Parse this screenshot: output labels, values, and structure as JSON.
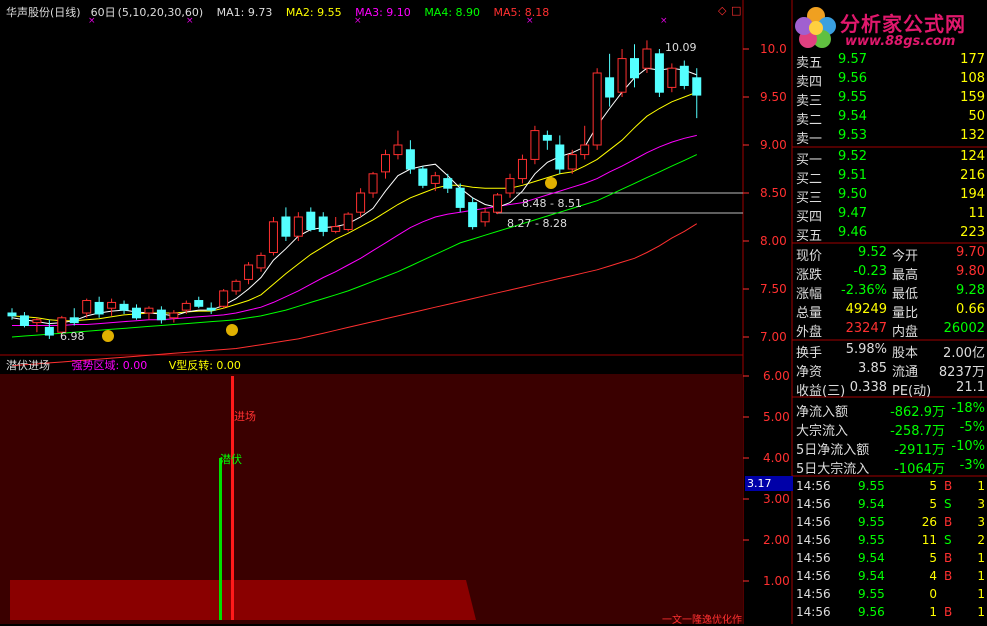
{
  "header": {
    "stock_name": "华声股份(日线)",
    "interval": "60日",
    "ma_params": "(5,10,20,30,60)",
    "ma1": "MA1: 9.73",
    "ma2": "MA2: 9.55",
    "ma3": "MA3: 9.10",
    "ma4": "MA4: 8.90",
    "ma5": "MA5: 8.18",
    "colors": {
      "ma1": "#ffffff",
      "ma2": "#ffff00",
      "ma3": "#ff00ff",
      "ma4": "#00ff00",
      "ma5": "#ff3030"
    }
  },
  "sub_header": {
    "title": "潜伏进场",
    "field1": "强势区域: 0.00",
    "field2": "V型反转: 0.00"
  },
  "price_axis": [
    "10.0",
    "9.50",
    "9.00",
    "8.50",
    "8.00",
    "7.50",
    "7.00"
  ],
  "indicator_axis": [
    "6.00",
    "5.00",
    "4.00",
    "3.00",
    "2.00",
    "1.00"
  ],
  "axis_tag": "3.17",
  "annotations": {
    "high": "10.09",
    "low": "6.98",
    "range1": "8.48 - 8.51",
    "range2": "8.27 - 8.28",
    "signal_enter": "进场",
    "signal_lurk": "潜伏",
    "footer": "一文一隆逸优化作"
  },
  "logo": {
    "title": "分析家公式网",
    "url": "www.88gs.com"
  },
  "order_book": {
    "sell": [
      {
        "label": "卖五",
        "price": "9.57",
        "vol": "177"
      },
      {
        "label": "卖四",
        "price": "9.56",
        "vol": "108"
      },
      {
        "label": "卖三",
        "price": "9.55",
        "vol": "159"
      },
      {
        "label": "卖二",
        "price": "9.54",
        "vol": "50"
      },
      {
        "label": "卖一",
        "price": "9.53",
        "vol": "132"
      }
    ],
    "buy": [
      {
        "label": "买一",
        "price": "9.52",
        "vol": "124"
      },
      {
        "label": "买二",
        "price": "9.51",
        "vol": "216"
      },
      {
        "label": "买三",
        "price": "9.50",
        "vol": "194"
      },
      {
        "label": "买四",
        "price": "9.47",
        "vol": "11"
      },
      {
        "label": "买五",
        "price": "9.46",
        "vol": "223"
      }
    ]
  },
  "stats": [
    {
      "l1": "现价",
      "v1": "9.52",
      "c1": "g",
      "l2": "今开",
      "v2": "9.70",
      "c2": "r"
    },
    {
      "l1": "涨跌",
      "v1": "-0.23",
      "c1": "g",
      "l2": "最高",
      "v2": "9.80",
      "c2": "r"
    },
    {
      "l1": "涨幅",
      "v1": "-2.36%",
      "c1": "g",
      "l2": "最低",
      "v2": "9.28",
      "c2": "g"
    },
    {
      "l1": "总量",
      "v1": "49249",
      "c1": "y",
      "l2": "量比",
      "v2": "0.66",
      "c2": "y"
    },
    {
      "l1": "外盘",
      "v1": "23247",
      "c1": "r",
      "l2": "内盘",
      "v2": "26002",
      "c2": "g"
    }
  ],
  "stats2": [
    {
      "l1": "换手",
      "v1": "5.98%",
      "l2": "股本",
      "v2": "2.00亿"
    },
    {
      "l1": "净资",
      "v1": "3.85",
      "l2": "流通",
      "v2": "8237万"
    },
    {
      "l1": "收益(三)",
      "v1": "0.338",
      "l2": "PE(动)",
      "v2": "21.1"
    }
  ],
  "flows": [
    {
      "label": "净流入额",
      "value": "-862.9万",
      "pct": "-18%"
    },
    {
      "label": "大宗流入",
      "value": "-258.7万",
      "pct": "-5%"
    },
    {
      "label": "5日净流入额",
      "value": "-2911万",
      "pct": "-10%"
    },
    {
      "label": "5日大宗流入",
      "value": "-1064万",
      "pct": "-3%"
    }
  ],
  "ticks": [
    {
      "time": "14:56",
      "price": "9.55",
      "vol": "5",
      "bs": "B",
      "n": "1"
    },
    {
      "time": "14:56",
      "price": "9.54",
      "vol": "5",
      "bs": "S",
      "n": "3"
    },
    {
      "time": "14:56",
      "price": "9.55",
      "vol": "26",
      "bs": "B",
      "n": "3"
    },
    {
      "time": "14:56",
      "price": "9.55",
      "vol": "11",
      "bs": "S",
      "n": "2"
    },
    {
      "time": "14:56",
      "price": "9.54",
      "vol": "5",
      "bs": "B",
      "n": "1"
    },
    {
      "time": "14:56",
      "price": "9.54",
      "vol": "4",
      "bs": "B",
      "n": "1"
    },
    {
      "time": "14:56",
      "price": "9.55",
      "vol": "0",
      "bs": "",
      "n": "1"
    },
    {
      "time": "14:56",
      "price": "9.56",
      "vol": "1",
      "bs": "B",
      "n": "1"
    }
  ],
  "chart_data": {
    "type": "candlestick",
    "ylim": [
      6.85,
      10.3
    ],
    "candles": [
      {
        "o": 7.25,
        "h": 7.3,
        "l": 7.18,
        "c": 7.22
      },
      {
        "o": 7.22,
        "h": 7.26,
        "l": 7.1,
        "c": 7.12
      },
      {
        "o": 7.15,
        "h": 7.2,
        "l": 7.05,
        "c": 7.18
      },
      {
        "o": 7.1,
        "h": 7.18,
        "l": 6.98,
        "c": 7.02
      },
      {
        "o": 7.05,
        "h": 7.22,
        "l": 7.02,
        "c": 7.2
      },
      {
        "o": 7.2,
        "h": 7.3,
        "l": 7.12,
        "c": 7.15
      },
      {
        "o": 7.25,
        "h": 7.4,
        "l": 7.2,
        "c": 7.38
      },
      {
        "o": 7.36,
        "h": 7.42,
        "l": 7.2,
        "c": 7.24
      },
      {
        "o": 7.3,
        "h": 7.4,
        "l": 7.22,
        "c": 7.36
      },
      {
        "o": 7.34,
        "h": 7.38,
        "l": 7.24,
        "c": 7.28
      },
      {
        "o": 7.3,
        "h": 7.34,
        "l": 7.18,
        "c": 7.2
      },
      {
        "o": 7.25,
        "h": 7.32,
        "l": 7.18,
        "c": 7.3
      },
      {
        "o": 7.28,
        "h": 7.32,
        "l": 7.14,
        "c": 7.18
      },
      {
        "o": 7.2,
        "h": 7.28,
        "l": 7.15,
        "c": 7.25
      },
      {
        "o": 7.28,
        "h": 7.38,
        "l": 7.24,
        "c": 7.35
      },
      {
        "o": 7.38,
        "h": 7.42,
        "l": 7.3,
        "c": 7.32
      },
      {
        "o": 7.3,
        "h": 7.36,
        "l": 7.24,
        "c": 7.28
      },
      {
        "o": 7.32,
        "h": 7.5,
        "l": 7.3,
        "c": 7.48
      },
      {
        "o": 7.48,
        "h": 7.6,
        "l": 7.44,
        "c": 7.58
      },
      {
        "o": 7.6,
        "h": 7.78,
        "l": 7.55,
        "c": 7.75
      },
      {
        "o": 7.72,
        "h": 7.88,
        "l": 7.68,
        "c": 7.85
      },
      {
        "o": 7.88,
        "h": 8.25,
        "l": 7.85,
        "c": 8.2
      },
      {
        "o": 8.25,
        "h": 8.35,
        "l": 8.0,
        "c": 8.05
      },
      {
        "o": 8.05,
        "h": 8.3,
        "l": 8.0,
        "c": 8.25
      },
      {
        "o": 8.3,
        "h": 8.35,
        "l": 8.1,
        "c": 8.12
      },
      {
        "o": 8.25,
        "h": 8.3,
        "l": 8.05,
        "c": 8.1
      },
      {
        "o": 8.1,
        "h": 8.25,
        "l": 8.08,
        "c": 8.15
      },
      {
        "o": 8.12,
        "h": 8.3,
        "l": 8.1,
        "c": 8.28
      },
      {
        "o": 8.3,
        "h": 8.55,
        "l": 8.25,
        "c": 8.5
      },
      {
        "o": 8.5,
        "h": 8.72,
        "l": 8.45,
        "c": 8.7
      },
      {
        "o": 8.72,
        "h": 8.95,
        "l": 8.65,
        "c": 8.9
      },
      {
        "o": 8.9,
        "h": 9.15,
        "l": 8.85,
        "c": 9.0
      },
      {
        "o": 8.95,
        "h": 9.05,
        "l": 8.7,
        "c": 8.75
      },
      {
        "o": 8.75,
        "h": 8.78,
        "l": 8.55,
        "c": 8.58
      },
      {
        "o": 8.6,
        "h": 8.72,
        "l": 8.52,
        "c": 8.68
      },
      {
        "o": 8.65,
        "h": 8.7,
        "l": 8.5,
        "c": 8.55
      },
      {
        "o": 8.55,
        "h": 8.6,
        "l": 8.3,
        "c": 8.35
      },
      {
        "o": 8.4,
        "h": 8.45,
        "l": 8.12,
        "c": 8.15
      },
      {
        "o": 8.2,
        "h": 8.35,
        "l": 8.15,
        "c": 8.3
      },
      {
        "o": 8.3,
        "h": 8.5,
        "l": 8.28,
        "c": 8.48
      },
      {
        "o": 8.5,
        "h": 8.7,
        "l": 8.45,
        "c": 8.65
      },
      {
        "o": 8.65,
        "h": 8.9,
        "l": 8.6,
        "c": 8.85
      },
      {
        "o": 8.85,
        "h": 9.2,
        "l": 8.8,
        "c": 9.15
      },
      {
        "o": 9.1,
        "h": 9.15,
        "l": 8.95,
        "c": 9.05
      },
      {
        "o": 9.0,
        "h": 9.1,
        "l": 8.7,
        "c": 8.75
      },
      {
        "o": 8.75,
        "h": 8.95,
        "l": 8.7,
        "c": 8.9
      },
      {
        "o": 8.9,
        "h": 9.2,
        "l": 8.85,
        "c": 9.0
      },
      {
        "o": 9.0,
        "h": 9.8,
        "l": 8.95,
        "c": 9.75
      },
      {
        "o": 9.7,
        "h": 9.95,
        "l": 9.4,
        "c": 9.5
      },
      {
        "o": 9.55,
        "h": 10.0,
        "l": 9.5,
        "c": 9.9
      },
      {
        "o": 9.9,
        "h": 10.05,
        "l": 9.6,
        "c": 9.7
      },
      {
        "o": 9.8,
        "h": 10.09,
        "l": 9.75,
        "c": 10.0
      },
      {
        "o": 9.95,
        "h": 10.0,
        "l": 9.5,
        "c": 9.55
      },
      {
        "o": 9.6,
        "h": 9.85,
        "l": 9.55,
        "c": 9.8
      },
      {
        "o": 9.82,
        "h": 9.88,
        "l": 9.58,
        "c": 9.62
      },
      {
        "o": 9.7,
        "h": 9.8,
        "l": 9.28,
        "c": 9.52
      }
    ],
    "ma1": [
      7.2,
      7.18,
      7.16,
      7.14,
      7.15,
      7.17,
      7.22,
      7.25,
      7.27,
      7.28,
      7.26,
      7.25,
      7.24,
      7.22,
      7.26,
      7.28,
      7.28,
      7.33,
      7.4,
      7.5,
      7.62,
      7.8,
      7.92,
      8.05,
      8.12,
      8.14,
      8.15,
      8.18,
      8.25,
      8.34,
      8.52,
      8.68,
      8.75,
      8.78,
      8.8,
      8.68,
      8.55,
      8.45,
      8.38,
      8.35,
      8.4,
      8.52,
      8.7,
      8.82,
      8.88,
      8.92,
      8.98,
      9.2,
      9.38,
      9.55,
      9.7,
      9.8,
      9.78,
      9.8,
      9.78,
      9.73
    ],
    "ma2": [
      7.22,
      7.21,
      7.2,
      7.18,
      7.17,
      7.17,
      7.18,
      7.19,
      7.21,
      7.23,
      7.24,
      7.25,
      7.25,
      7.25,
      7.26,
      7.27,
      7.27,
      7.3,
      7.34,
      7.38,
      7.44,
      7.55,
      7.66,
      7.76,
      7.86,
      7.94,
      8.02,
      8.08,
      8.15,
      8.22,
      8.3,
      8.38,
      8.45,
      8.5,
      8.55,
      8.58,
      8.58,
      8.56,
      8.55,
      8.55,
      8.55,
      8.58,
      8.62,
      8.66,
      8.7,
      8.72,
      8.78,
      8.85,
      8.95,
      9.05,
      9.18,
      9.3,
      9.38,
      9.45,
      9.5,
      9.55
    ],
    "ma3": [
      7.12,
      7.12,
      7.12,
      7.12,
      7.12,
      7.13,
      7.13,
      7.14,
      7.15,
      7.16,
      7.17,
      7.18,
      7.18,
      7.19,
      7.2,
      7.21,
      7.22,
      7.23,
      7.25,
      7.28,
      7.31,
      7.36,
      7.42,
      7.48,
      7.55,
      7.62,
      7.68,
      7.75,
      7.82,
      7.9,
      7.98,
      8.06,
      8.14,
      8.2,
      8.25,
      8.28,
      8.3,
      8.32,
      8.34,
      8.36,
      8.38,
      8.4,
      8.44,
      8.48,
      8.52,
      8.56,
      8.6,
      8.65,
      8.72,
      8.78,
      8.85,
      8.92,
      8.98,
      9.03,
      9.07,
      9.1
    ],
    "ma4": [
      7.0,
      7.01,
      7.02,
      7.03,
      7.04,
      7.05,
      7.06,
      7.07,
      7.08,
      7.09,
      7.1,
      7.11,
      7.12,
      7.13,
      7.14,
      7.15,
      7.16,
      7.17,
      7.18,
      7.2,
      7.22,
      7.25,
      7.28,
      7.32,
      7.36,
      7.4,
      7.44,
      7.48,
      7.53,
      7.58,
      7.63,
      7.68,
      7.74,
      7.8,
      7.86,
      7.92,
      7.98,
      8.02,
      8.06,
      8.1,
      8.14,
      8.18,
      8.22,
      8.26,
      8.3,
      8.34,
      8.38,
      8.42,
      8.48,
      8.54,
      8.6,
      8.66,
      8.72,
      8.78,
      8.84,
      8.9
    ],
    "ma5": [
      6.7,
      6.71,
      6.72,
      6.73,
      6.74,
      6.75,
      6.76,
      6.77,
      6.78,
      6.79,
      6.8,
      6.81,
      6.82,
      6.83,
      6.84,
      6.85,
      6.86,
      6.87,
      6.88,
      6.9,
      6.92,
      6.94,
      6.96,
      6.98,
      7.01,
      7.04,
      7.07,
      7.1,
      7.13,
      7.16,
      7.19,
      7.22,
      7.25,
      7.28,
      7.31,
      7.34,
      7.37,
      7.4,
      7.43,
      7.46,
      7.49,
      7.52,
      7.55,
      7.58,
      7.61,
      7.64,
      7.67,
      7.7,
      7.74,
      7.78,
      7.82,
      7.88,
      7.95,
      8.03,
      8.1,
      8.18
    ]
  }
}
